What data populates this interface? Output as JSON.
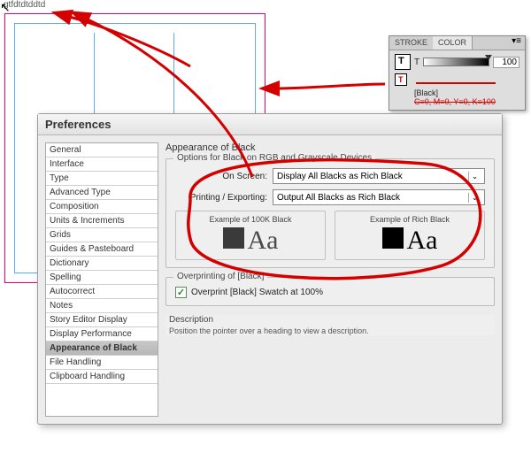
{
  "canvas": {
    "sample_text": "gtfdtdtddtd",
    "cursor_glyph": "↖"
  },
  "color_panel": {
    "tabs": {
      "stroke": "STROKE",
      "color": "COLOR"
    },
    "tint_label": "T",
    "tint_value": "100",
    "name": "[Black]",
    "breakdown": "C=0, M=0, Y=0, K=100"
  },
  "dialog": {
    "title": "Preferences",
    "categories": [
      "General",
      "Interface",
      "Type",
      "Advanced Type",
      "Composition",
      "Units & Increments",
      "Grids",
      "Guides & Pasteboard",
      "Dictionary",
      "Spelling",
      "Autocorrect",
      "Notes",
      "Story Editor Display",
      "Display Performance",
      "Appearance of Black",
      "File Handling",
      "Clipboard Handling"
    ],
    "selected_category_index": 14,
    "section_title": "Appearance of Black",
    "options_group": {
      "label": "Options for Black on RGB and Grayscale Devices",
      "onscreen_label": "On Screen:",
      "onscreen_value": "Display All Blacks as Rich Black",
      "print_label": "Printing / Exporting:",
      "print_value": "Output All Blacks as Rich Black",
      "example_100k_label": "Example of 100K Black",
      "example_rich_label": "Example of Rich Black",
      "aa": "Aa"
    },
    "overprint_group": {
      "label": "Overprinting of [Black]",
      "checked": true,
      "text": "Overprint [Black] Swatch at 100%"
    },
    "description_group": {
      "label": "Description",
      "text": "Position the pointer over a heading to view a description."
    }
  },
  "annotation_color": "#d40000"
}
